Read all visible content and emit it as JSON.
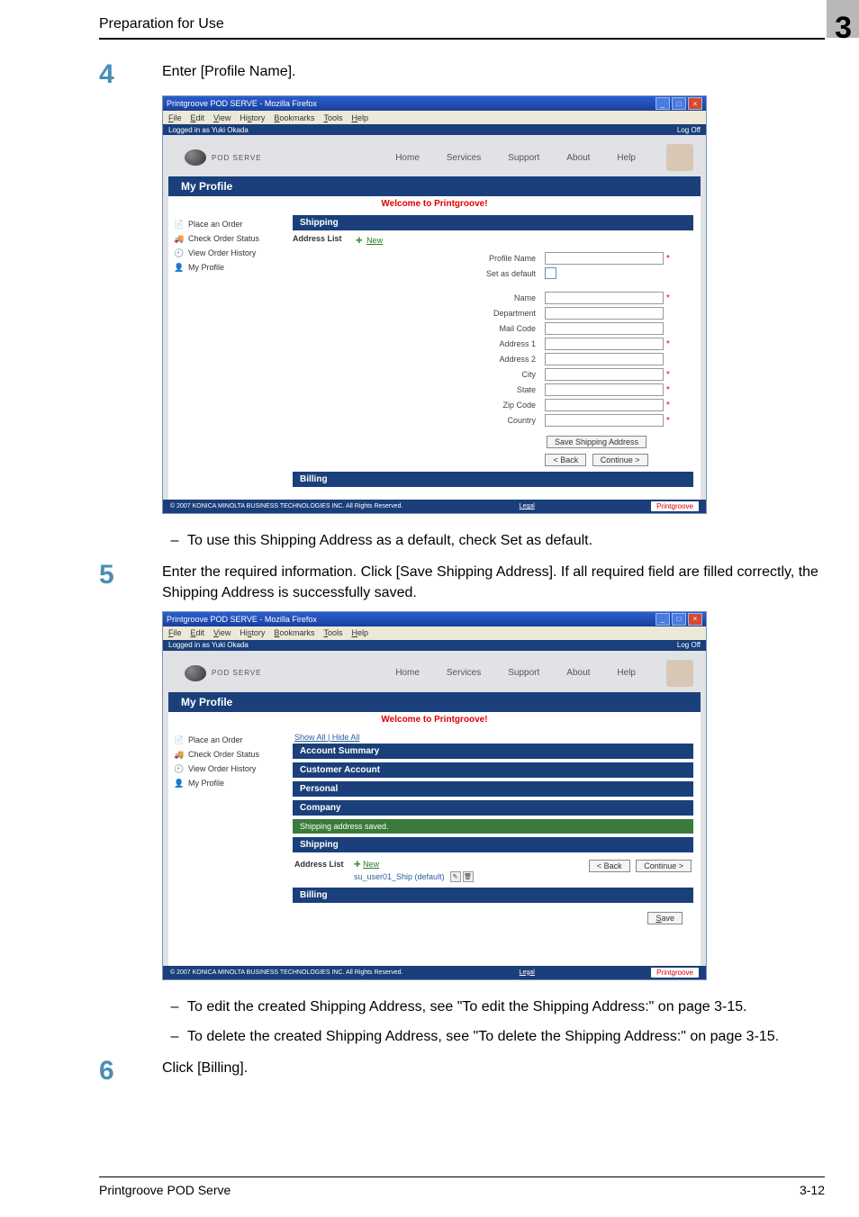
{
  "doc": {
    "header": "Preparation for Use",
    "chapter": "3",
    "footer_left": "Printgroove POD Serve",
    "footer_right": "3-12"
  },
  "steps": {
    "s4": {
      "num": "4",
      "text": "Enter [Profile Name]."
    },
    "s5": {
      "num": "5",
      "text": "Enter the required information. Click [Save Shipping Address]. If all required field are filled correctly, the Shipping Address is successfully saved."
    },
    "s6": {
      "num": "6",
      "text": "Click [Billing]."
    }
  },
  "bullets": {
    "b1": "To use this Shipping Address as a default, check Set as default.",
    "b2": "To edit the created Shipping Address, see \"To edit the Shipping Address:\" on page 3-15.",
    "b3": "To delete the created Shipping Address, see \"To delete the Shipping Address:\" on page 3-15."
  },
  "ss_common": {
    "titlebar": "Printgroove POD SERVE - Mozilla Firefox",
    "menubar": {
      "file": "File",
      "edit": "Edit",
      "view": "View",
      "history": "History",
      "bookmarks": "Bookmarks",
      "tools": "Tools",
      "help": "Help"
    },
    "login_left": "Logged in as Yuki Okada",
    "login_right": "Log Off",
    "logo_text": "POD SERVE",
    "nav": {
      "home": "Home",
      "services": "Services",
      "support": "Support",
      "about": "About",
      "help": "Help"
    },
    "myprofile": "My Profile",
    "welcome": "Welcome to Printgroove!",
    "sidebar": {
      "place": "Place an Order",
      "status": "Check Order Status",
      "history": "View Order History",
      "profile": "My Profile"
    },
    "footer_copy": "© 2007 KONICA MINOLTA BUSINESS TECHNOLOGIES INC. All Rights Reserved.",
    "footer_legal": "Legal",
    "footer_brand": "Printgroove"
  },
  "ss1": {
    "shipping": "Shipping",
    "address_list_label": "Address List",
    "new_link": "New",
    "fields": {
      "profile_name": "Profile Name",
      "set_default": "Set as default",
      "name": "Name",
      "department": "Department",
      "mail_code": "Mail Code",
      "address1": "Address 1",
      "address2": "Address 2",
      "city": "City",
      "state": "State",
      "zip": "Zip Code",
      "country": "Country"
    },
    "save_btn": "Save Shipping Address",
    "back_btn": "< Back",
    "continue_btn": "Continue >",
    "billing": "Billing"
  },
  "ss2": {
    "showall": "Show All | Hide All",
    "sections": {
      "account_summary": "Account Summary",
      "customer_account": "Customer Account",
      "personal": "Personal",
      "company": "Company",
      "saved_msg": "Shipping address saved.",
      "shipping": "Shipping",
      "billing": "Billing"
    },
    "address_list_label": "Address List",
    "new_link": "New",
    "addr_item": "su_user01_Ship (default)",
    "back_btn": "< Back",
    "continue_btn": "Continue >",
    "save_btn": "Save"
  }
}
